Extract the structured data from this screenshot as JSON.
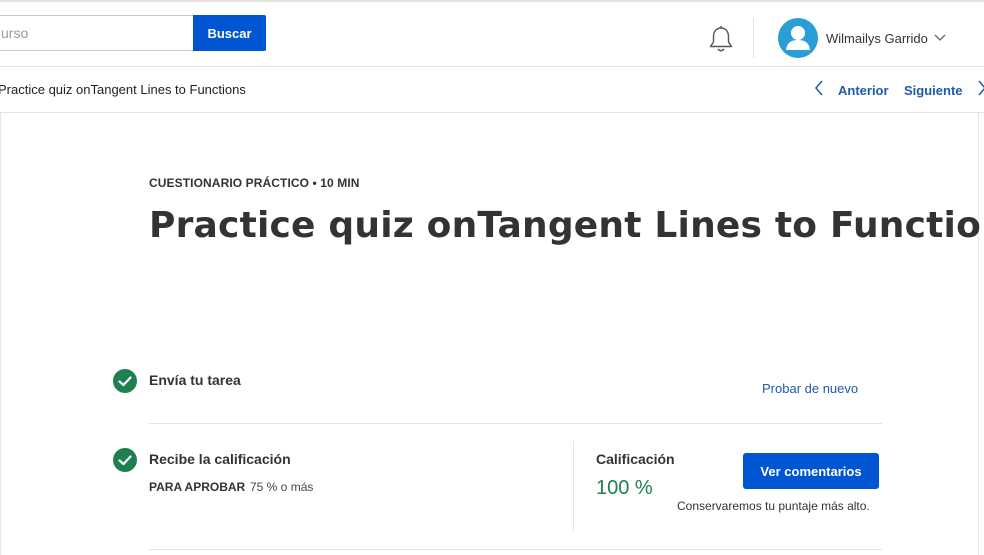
{
  "header": {
    "search": {
      "placeholder": "urso",
      "button_label": "Buscar"
    },
    "bell_icon": "bell-icon",
    "user": {
      "name": "Wilmailys Garrido",
      "avatar_icon": "user-avatar-icon",
      "avatar_color": "#2a9fd6"
    }
  },
  "breadcrumb": {
    "current": "Practice quiz onTangent Lines to Functions",
    "prev_label": "Anterior",
    "next_label": "Siguiente"
  },
  "main": {
    "eyebrow": "CUESTIONARIO PRÁCTICO • 10 MIN",
    "title": "Practice quiz onTangent Lines to Functions",
    "steps": [
      {
        "label": "Envía tu tarea",
        "action_label": "Probar de nuevo",
        "done": true
      },
      {
        "label": "Recibe la calificación",
        "pass_label": "PARA APROBAR",
        "pass_value": "75 % o más",
        "done": true
      }
    ],
    "grade": {
      "label": "Calificación",
      "value": "100 %",
      "button_label": "Ver comentarios",
      "note": "Conservaremos tu puntaje más alto."
    }
  },
  "colors": {
    "accent": "#0056d2",
    "link": "#1f5aa8",
    "success": "#1e7f4f"
  }
}
